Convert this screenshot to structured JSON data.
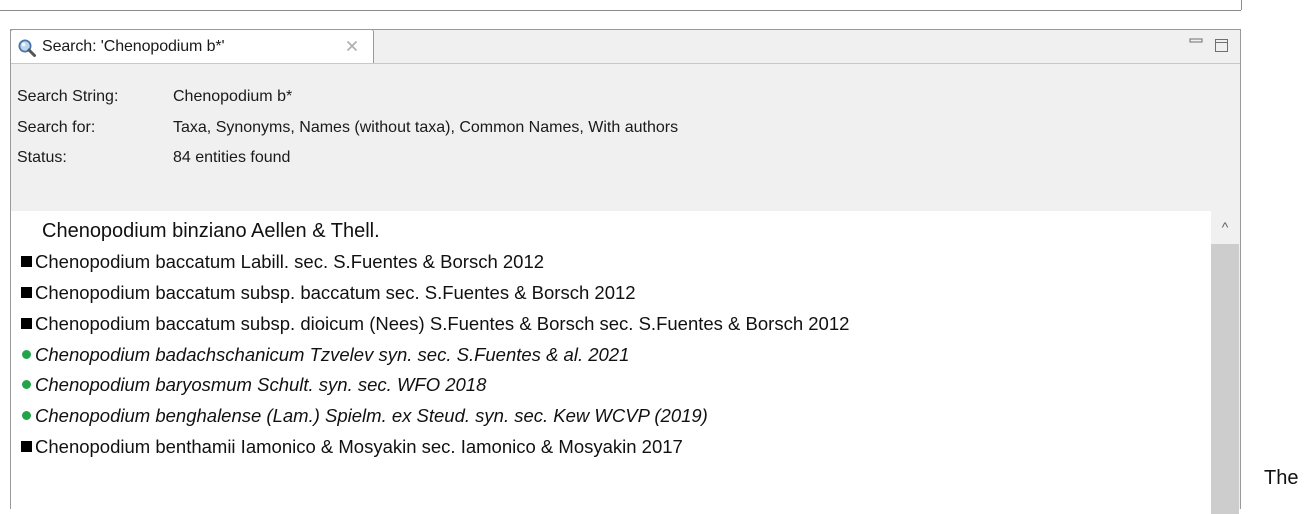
{
  "tab": {
    "title": "Search: 'Chenopodium b*'",
    "icon": "search-icon",
    "close_icon": "close-icon"
  },
  "window_controls": {
    "minimize_icon": "minimize-icon",
    "maximize_icon": "maximize-icon"
  },
  "info": {
    "search_string": {
      "label": "Search String:",
      "value": "Chenopodium b*"
    },
    "search_for": {
      "label": "Search for:",
      "value": "Taxa, Synonyms, Names (without taxa), Common Names, With authors"
    },
    "status": {
      "label": "Status:",
      "value": "84 entities found"
    }
  },
  "results": {
    "group_title": "Chenopodium binziano Aellen & Thell.",
    "items": [
      {
        "kind": "accepted",
        "text": "Chenopodium baccatum Labill. sec. S.Fuentes & Borsch 2012"
      },
      {
        "kind": "accepted",
        "text": "Chenopodium baccatum subsp. baccatum sec. S.Fuentes & Borsch 2012"
      },
      {
        "kind": "accepted",
        "text": "Chenopodium baccatum subsp. dioicum (Nees) S.Fuentes & Borsch sec. S.Fuentes & Borsch 2012"
      },
      {
        "kind": "synonym",
        "text": "Chenopodium badachschanicum Tzvelev syn. sec. S.Fuentes & al. 2021"
      },
      {
        "kind": "synonym",
        "text": "Chenopodium baryosmum Schult. syn. sec. WFO 2018"
      },
      {
        "kind": "synonym",
        "text": "Chenopodium benghalense (Lam.) Spielm. ex Steud. syn. sec. Kew WCVP (2019)"
      },
      {
        "kind": "accepted",
        "text": "Chenopodium benthamii Iamonico & Mosyakin sec. Iamonico & Mosyakin 2017"
      }
    ],
    "colors": {
      "synonym_dot": "#23a34a",
      "accepted_square": "#000000"
    }
  },
  "scrollbar": {
    "up_arrow": "^"
  },
  "stray_text": "The"
}
